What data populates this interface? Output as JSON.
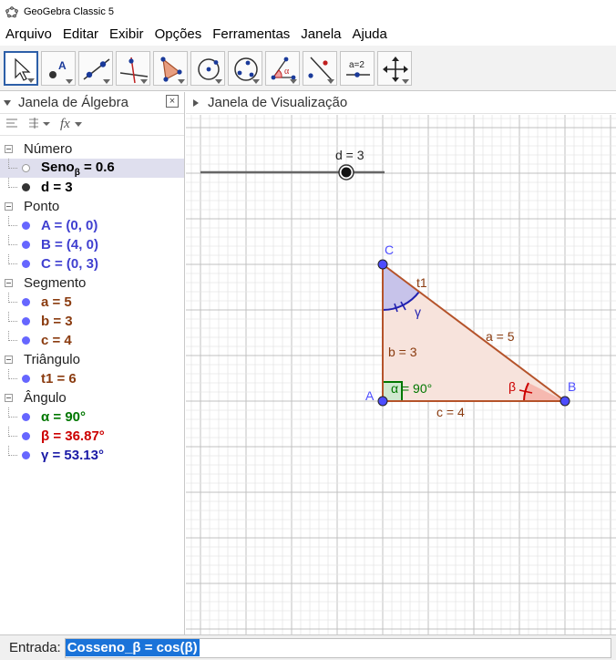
{
  "window": {
    "title": "GeoGebra Classic 5"
  },
  "menu": [
    "Arquivo",
    "Editar",
    "Exibir",
    "Opções",
    "Ferramentas",
    "Janela",
    "Ajuda"
  ],
  "toolbar": {
    "tools": [
      "move-tool",
      "point-tool",
      "line-tool",
      "perpendicular-tool",
      "polygon-tool",
      "circle-tool",
      "conic-tool",
      "angle-tool",
      "reflect-tool",
      "slider-tool",
      "move-view-tool"
    ],
    "slider_tool_label": "a=2"
  },
  "algebra": {
    "title": "Janela de Álgebra",
    "close": "×",
    "fx": "fx",
    "categories": [
      {
        "name": "Número",
        "items": [
          {
            "text": "Seno",
            "sub": "β",
            "rest": " = 0.6",
            "color": "#000000",
            "dot": "hollow",
            "selected": true
          },
          {
            "text": "d = 3",
            "color": "#000000",
            "dot": "black"
          }
        ]
      },
      {
        "name": "Ponto",
        "items": [
          {
            "text": "A = (0, 0)",
            "color": "#4040d0",
            "dot": "blue"
          },
          {
            "text": "B = (4, 0)",
            "color": "#4040d0",
            "dot": "blue"
          },
          {
            "text": "C = (0, 3)",
            "color": "#4040d0",
            "dot": "blue"
          }
        ]
      },
      {
        "name": "Segmento",
        "items": [
          {
            "text": "a = 5",
            "color": "#8a3b0f",
            "dot": "blue"
          },
          {
            "text": "b = 3",
            "color": "#8a3b0f",
            "dot": "blue"
          },
          {
            "text": "c = 4",
            "color": "#8a3b0f",
            "dot": "blue"
          }
        ]
      },
      {
        "name": "Triângulo",
        "items": [
          {
            "text": "t1 = 6",
            "color": "#8a3b0f",
            "dot": "blue"
          }
        ]
      },
      {
        "name": "Ângulo",
        "items": [
          {
            "text": "α = 90°",
            "color": "#007700",
            "dot": "blue"
          },
          {
            "text": "β = 36.87°",
            "color": "#cc0000",
            "dot": "blue"
          },
          {
            "text": "γ = 53.13°",
            "color": "#1a1aa6",
            "dot": "blue"
          }
        ]
      }
    ]
  },
  "graphics": {
    "title": "Janela de Visualização",
    "slider_label": "d = 3",
    "labels": {
      "C": "C",
      "A": "A",
      "B": "B",
      "t1": "t1",
      "a": "a = 5",
      "b": "b = 3",
      "c": "c = 4",
      "alpha": "α = 90°",
      "beta": "β",
      "gamma": "γ"
    }
  },
  "input": {
    "label": "Entrada:",
    "value": "Cosseno_β = cos(β)"
  },
  "colors": {
    "point": "#4d4dff",
    "segment": "#b5532a",
    "triangle_fill": "#f7e3dc",
    "alpha": "#007700",
    "beta": "#cc0000",
    "gamma": "#2020b0",
    "gamma_fill": "#c7c3ea",
    "grid_minor": "#e6e6e6",
    "grid_major": "#c0c0c0",
    "accent": "#2d5fa8",
    "selection": "#1a73d9"
  }
}
